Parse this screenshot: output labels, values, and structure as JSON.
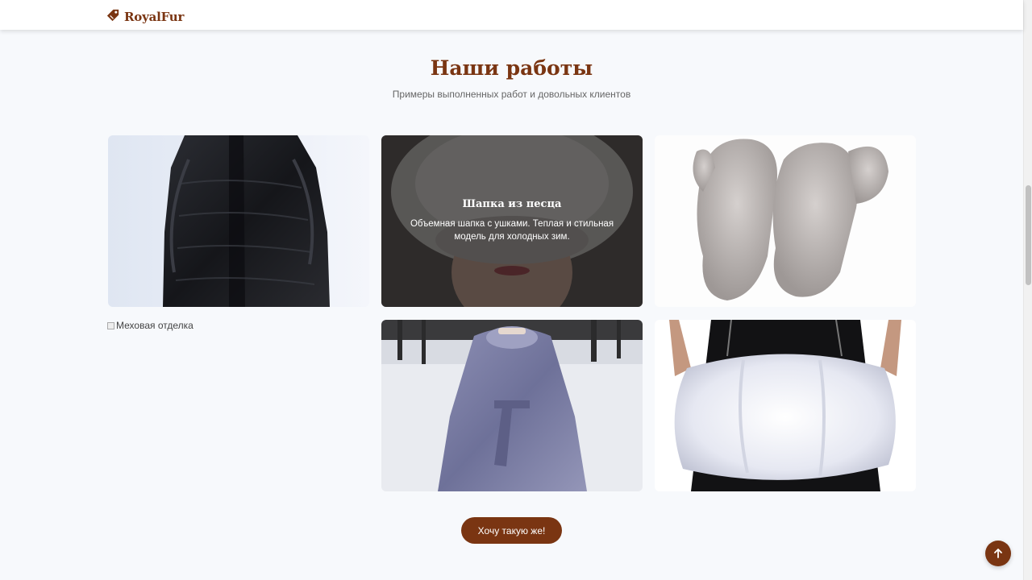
{
  "brand": {
    "name": "RoyalFur",
    "icon": "tag-icon",
    "color": "#7a3512"
  },
  "section": {
    "title": "Наши работы",
    "subtitle": "Примеры выполненных работ и довольных клиентов"
  },
  "gallery": [
    {
      "id": "mink-coat",
      "title": "",
      "description": ""
    },
    {
      "id": "fox-hat",
      "title": "Шапка из песца",
      "description": "Объемная шапка с ушками. Теплая и стильная модель для холодных зим."
    },
    {
      "id": "fur-mittens",
      "title": "",
      "description": ""
    },
    {
      "id": "fur-trim",
      "alt": "Меховая отделка"
    },
    {
      "id": "blue-mink-coat",
      "title": "",
      "description": ""
    },
    {
      "id": "fox-muff",
      "title": "",
      "description": ""
    }
  ],
  "cta": {
    "label": "Хочу такую же!"
  },
  "scroll_top": {
    "icon": "arrow-up-icon"
  }
}
